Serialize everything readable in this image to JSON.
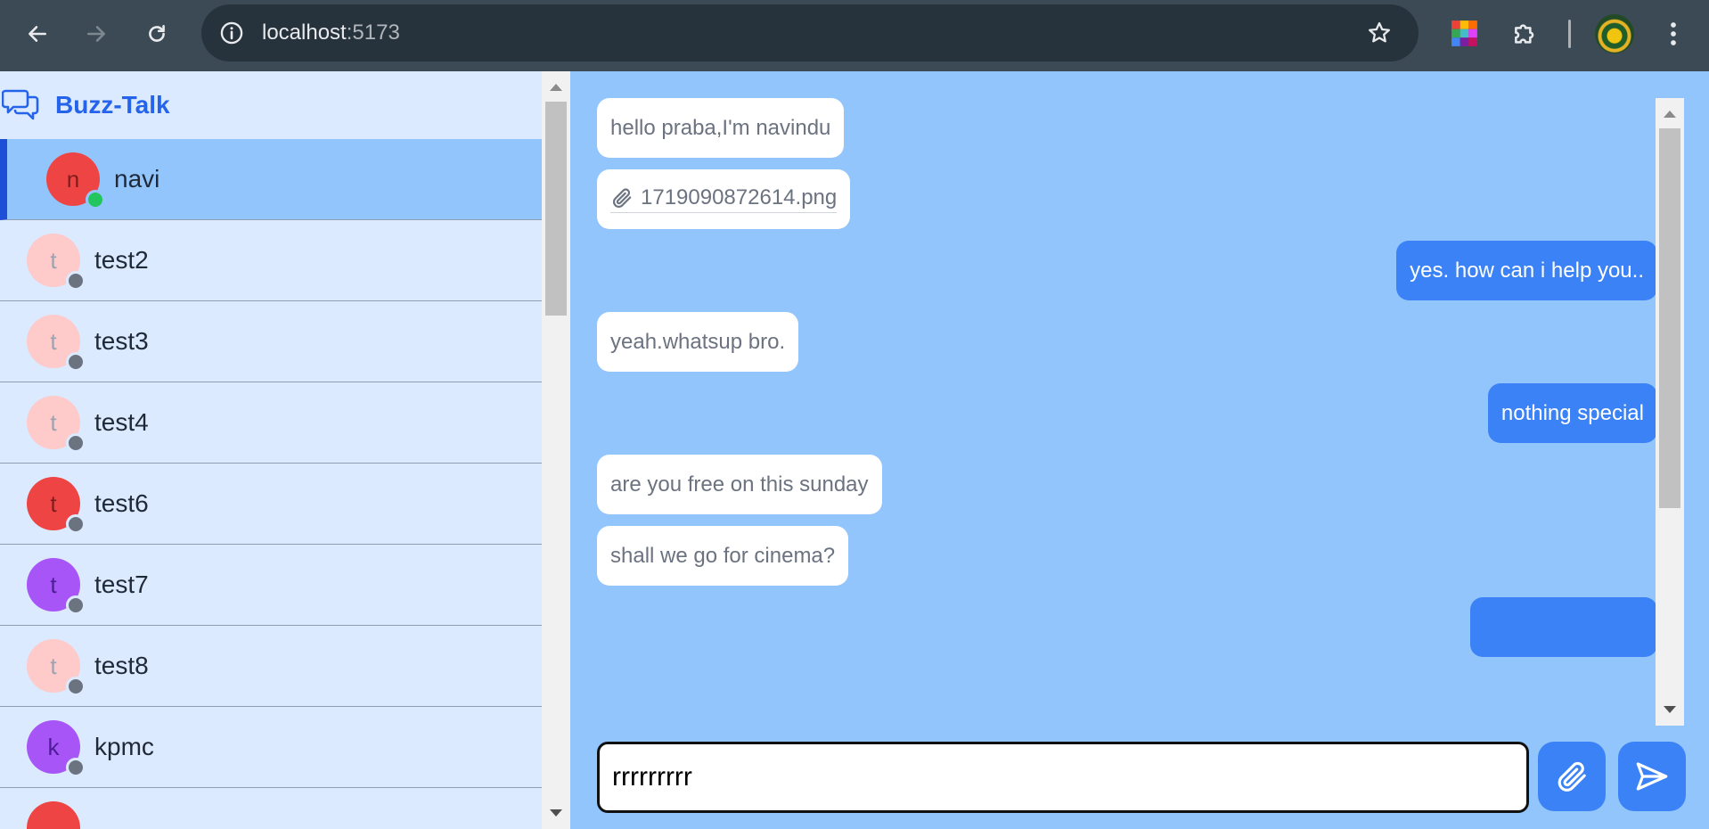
{
  "browser": {
    "url_host": "localhost",
    "url_port": ":5173",
    "icons": {
      "back": "arrow-left-icon",
      "forward": "arrow-right-icon",
      "reload": "reload-icon",
      "info": "info-icon",
      "bookmark": "star-icon",
      "extension_color": "color-grid-icon",
      "extensions": "puzzle-icon",
      "menu": "kebab-menu-icon"
    }
  },
  "app": {
    "name": "Buzz-Talk",
    "brand_color": "#2563eb"
  },
  "contacts": [
    {
      "initial": "n",
      "name": "navi",
      "avatar_bg": "#ef4444",
      "initial_color": "#7f1d1d",
      "status": "online",
      "status_color": "#22c55e",
      "active": true
    },
    {
      "initial": "t",
      "name": "test2",
      "avatar_bg": "#fecaca",
      "initial_color": "#9ca3af",
      "status": "offline",
      "status_color": "#6b7280",
      "active": false
    },
    {
      "initial": "t",
      "name": "test3",
      "avatar_bg": "#fecaca",
      "initial_color": "#9ca3af",
      "status": "offline",
      "status_color": "#6b7280",
      "active": false
    },
    {
      "initial": "t",
      "name": "test4",
      "avatar_bg": "#fecaca",
      "initial_color": "#9ca3af",
      "status": "offline",
      "status_color": "#6b7280",
      "active": false
    },
    {
      "initial": "t",
      "name": "test6",
      "avatar_bg": "#ef4444",
      "initial_color": "#7f1d1d",
      "status": "offline",
      "status_color": "#6b7280",
      "active": false
    },
    {
      "initial": "t",
      "name": "test7",
      "avatar_bg": "#a855f7",
      "initial_color": "#4c1d95",
      "status": "offline",
      "status_color": "#6b7280",
      "active": false
    },
    {
      "initial": "t",
      "name": "test8",
      "avatar_bg": "#fecaca",
      "initial_color": "#9ca3af",
      "status": "offline",
      "status_color": "#6b7280",
      "active": false
    },
    {
      "initial": "k",
      "name": "kpmc",
      "avatar_bg": "#a855f7",
      "initial_color": "#4c1d95",
      "status": "offline",
      "status_color": "#6b7280",
      "active": false
    },
    {
      "initial": "",
      "name": "",
      "avatar_bg": "#ef4444",
      "initial_color": "#7f1d1d",
      "status": "offline",
      "status_color": "#6b7280",
      "active": false
    }
  ],
  "messages": [
    {
      "direction": "in",
      "type": "text",
      "text": "hello praba,I'm navindu"
    },
    {
      "direction": "in",
      "type": "file",
      "text": "1719090872614.png",
      "icon": "paperclip-icon"
    },
    {
      "direction": "out",
      "type": "text",
      "text": "yes. how can i help you.."
    },
    {
      "direction": "in",
      "type": "text",
      "text": "yeah.whatsup bro."
    },
    {
      "direction": "out",
      "type": "text",
      "text": "nothing special"
    },
    {
      "direction": "in",
      "type": "text",
      "text": "are you free on this sunday"
    },
    {
      "direction": "in",
      "type": "text",
      "text": "shall we go for cinema?"
    },
    {
      "direction": "out",
      "type": "text",
      "text": ""
    }
  ],
  "composer": {
    "value": "rrrrrrrrr",
    "attach_icon": "paperclip-icon",
    "send_icon": "send-icon"
  },
  "colors": {
    "chat_bg": "#93c5fd",
    "sidebar_bg": "#dbeafe",
    "outgoing_bubble": "#3b82f6",
    "incoming_bubble": "#ffffff"
  }
}
